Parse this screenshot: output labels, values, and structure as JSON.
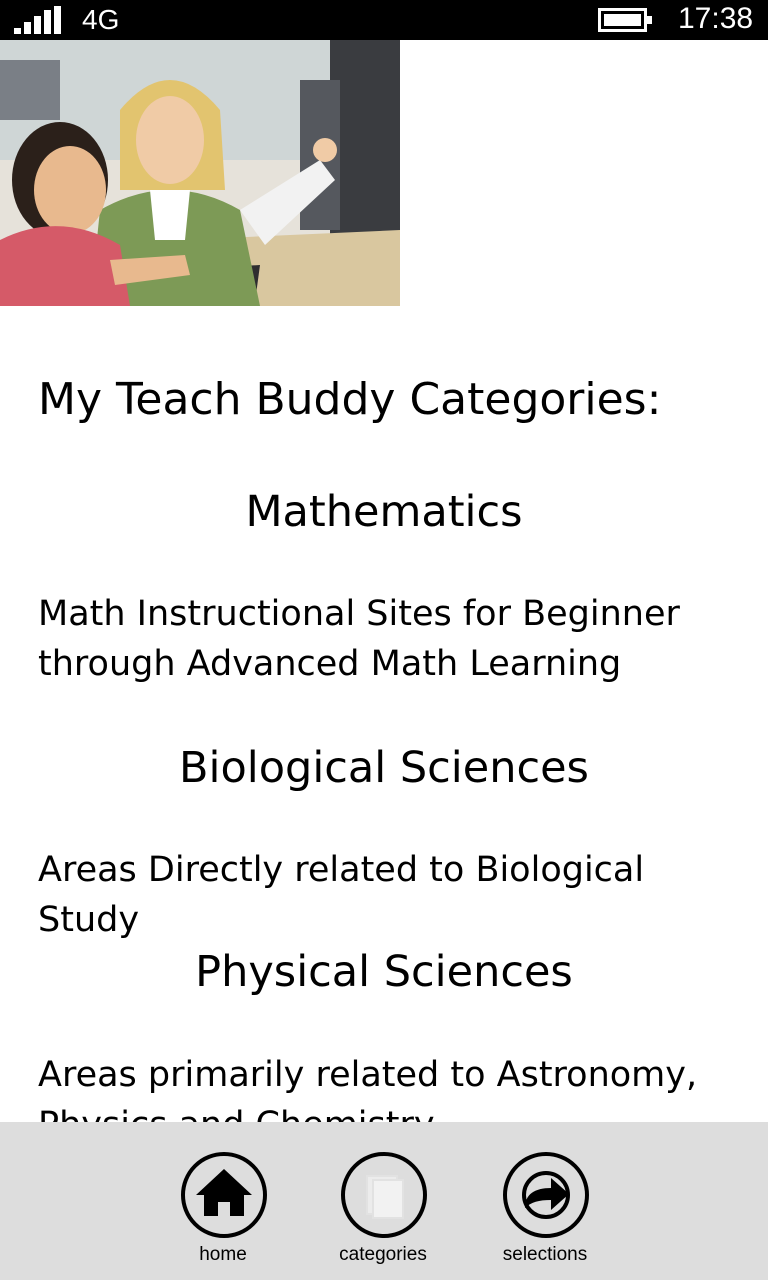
{
  "status_bar": {
    "network": "4G",
    "time": "17:38"
  },
  "main": {
    "title": "My Teach Buddy Categories:",
    "categories": [
      {
        "name": "Mathematics",
        "description": "Math Instructional Sites for Beginner through Advanced Math Learning"
      },
      {
        "name": "Biological Sciences",
        "description": "Areas Directly related to Biological Study"
      },
      {
        "name": "Physical Sciences",
        "description": "Areas primarily related to Astronomy, Physics and Chemistry"
      }
    ]
  },
  "app_bar": {
    "buttons": [
      {
        "label": "home",
        "icon": "home-icon"
      },
      {
        "label": "categories",
        "icon": "categories-icon"
      },
      {
        "label": "selections",
        "icon": "share-icon"
      }
    ],
    "background": "#dddddd"
  }
}
